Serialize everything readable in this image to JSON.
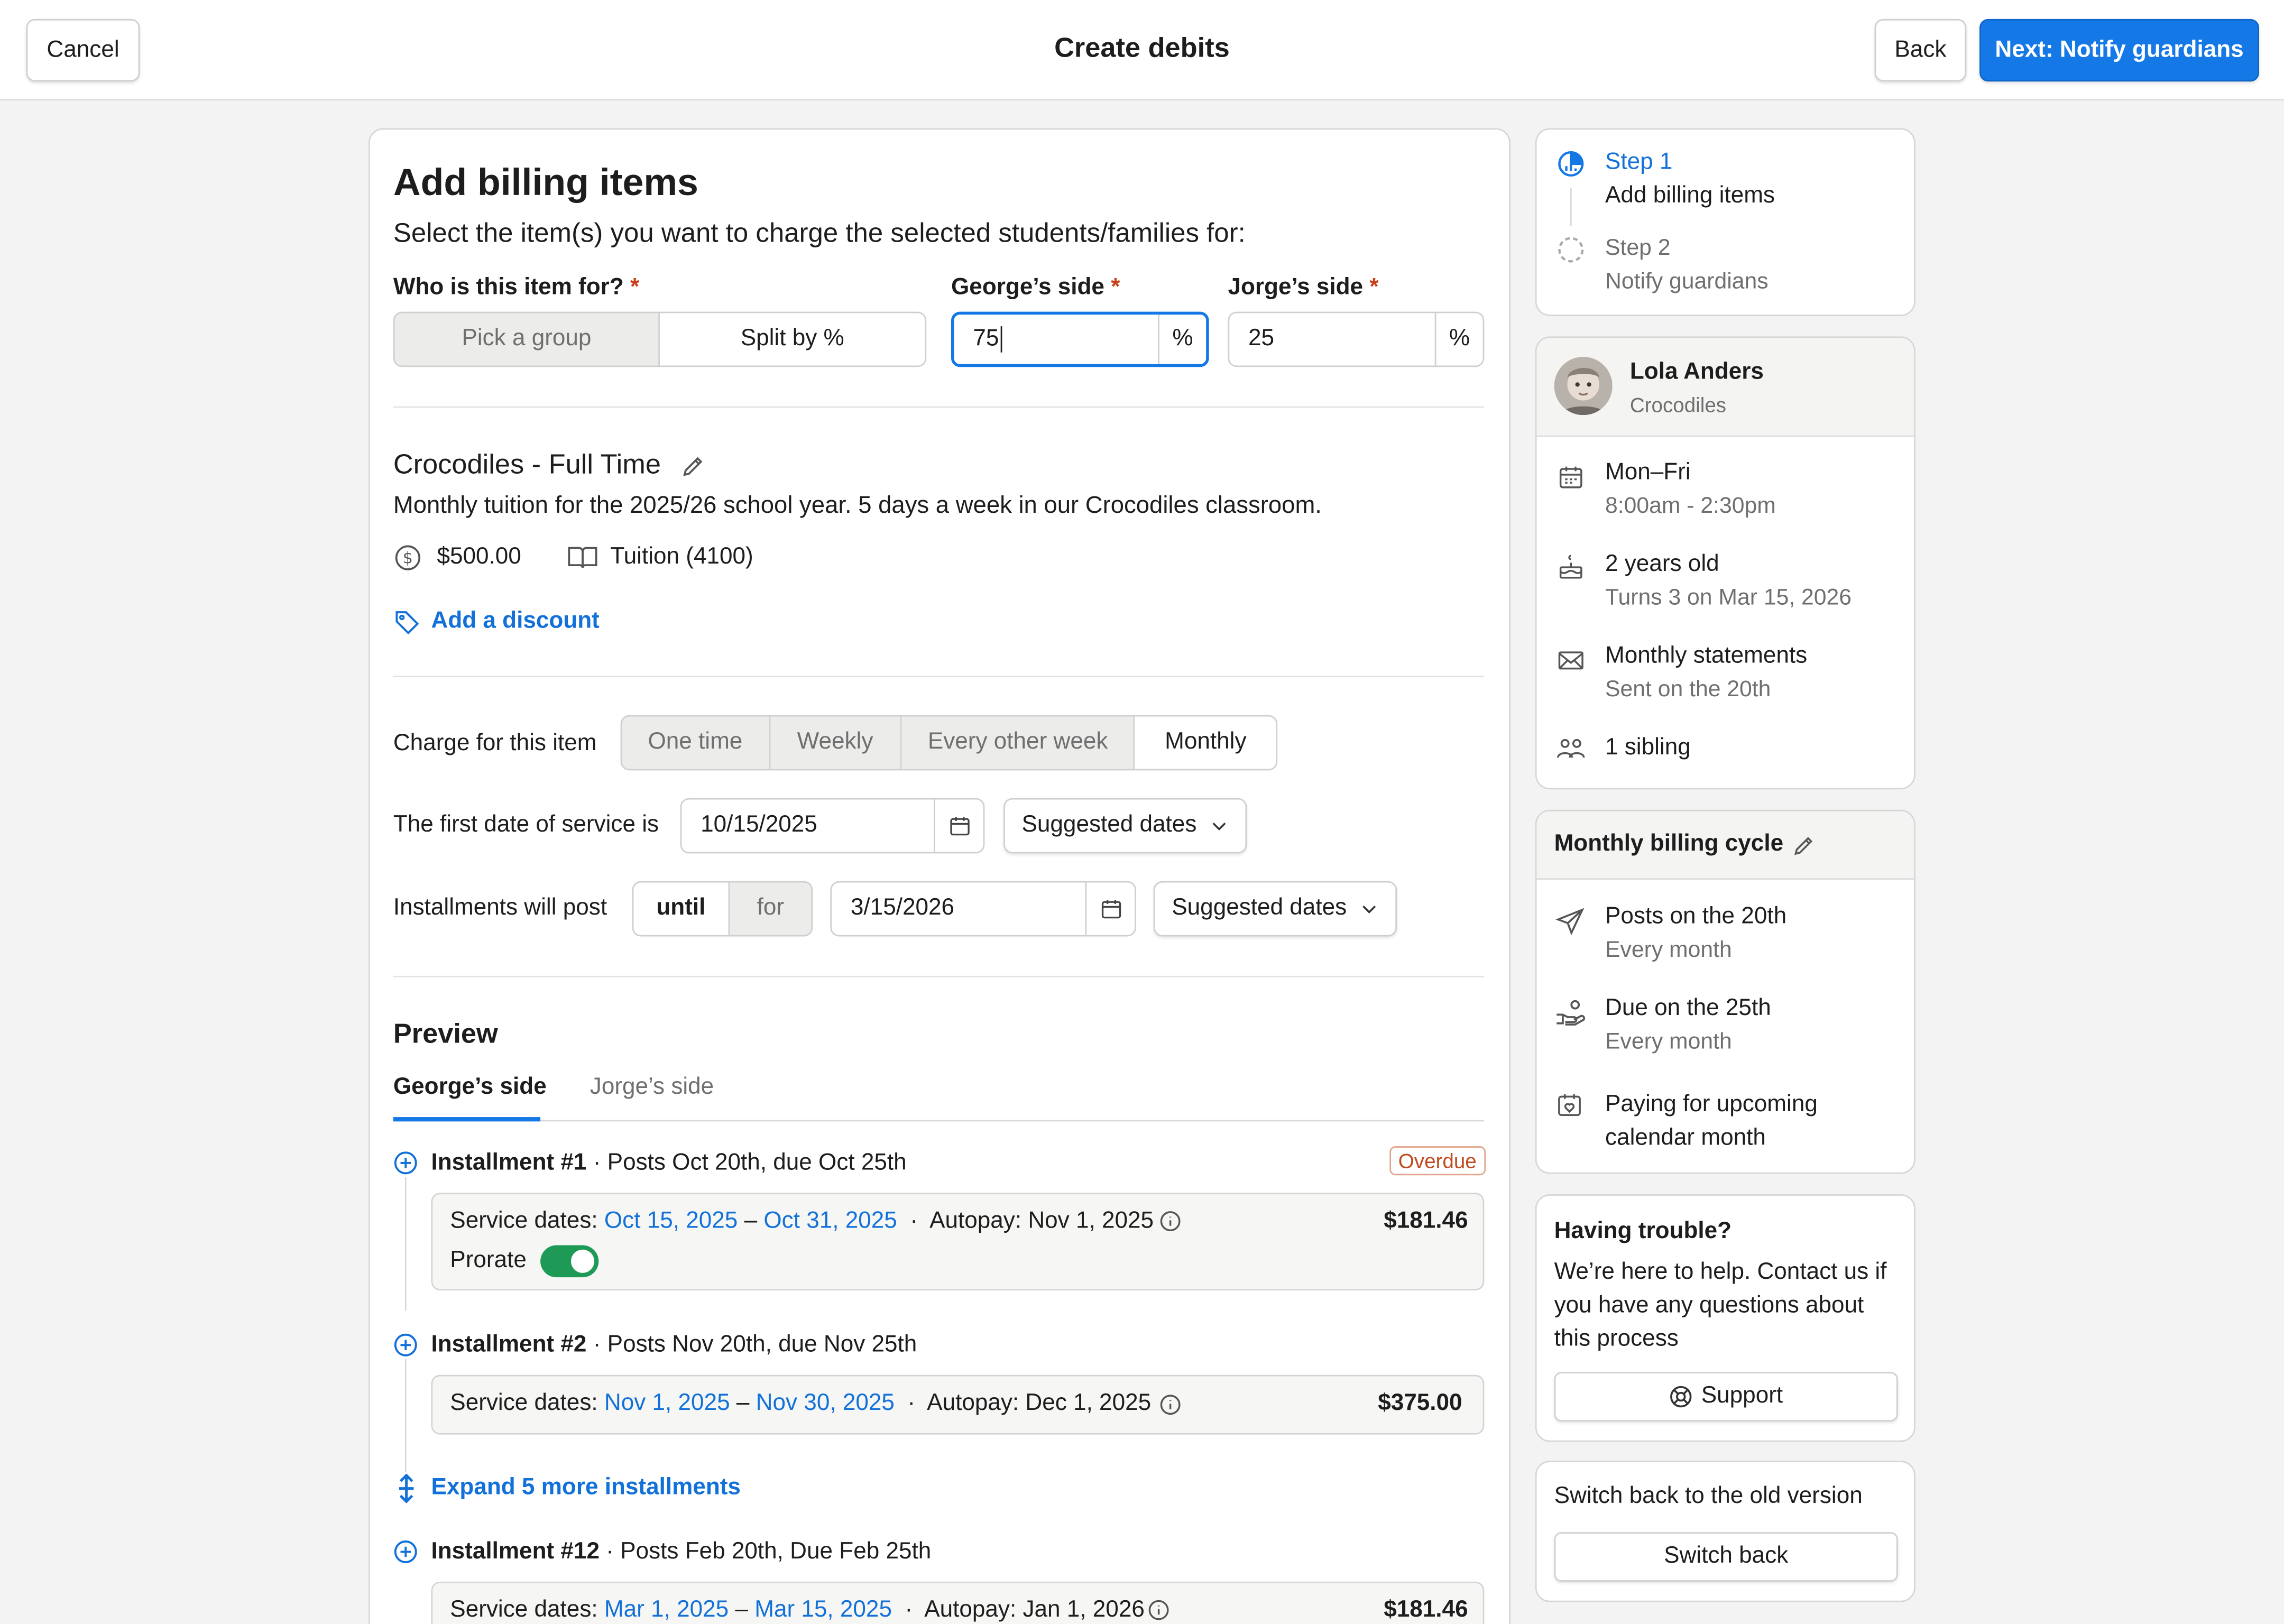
{
  "header": {
    "cancel_label": "Cancel",
    "title": "Create debits",
    "back_label": "Back",
    "next_label": "Next: Notify guardians"
  },
  "billing": {
    "title": "Add billing items",
    "subtitle": "Select the item(s) you want to charge the selected students/families for:",
    "who_label": "Who is this item for?",
    "who_options": [
      "Pick a group",
      "Split by %"
    ],
    "who_selected": "Split by %",
    "george_label": "George’s side",
    "george_value": "75",
    "jorge_label": "Jorge’s side",
    "jorge_value": "25",
    "percent": "%",
    "required_mark": "*"
  },
  "item": {
    "name": "Crocodiles - Full Time",
    "description": "Monthly tuition for the 2025/26 school year. 5 days a week in our Crocodiles classroom.",
    "price": "$500.00",
    "account": "Tuition (4100)",
    "discount_label": "Add a discount"
  },
  "charge": {
    "label": "Charge for this item",
    "options": [
      "One time",
      "Weekly",
      "Every other week",
      "Monthly"
    ],
    "selected": "Monthly",
    "first_date_label": "The first date of service is",
    "first_date": "10/15/2025",
    "suggested_label": "Suggested dates",
    "installments_label": "Installments will post",
    "until_label": "until",
    "for_label": "for",
    "end_date": "3/15/2026"
  },
  "preview": {
    "title": "Preview",
    "tabs": [
      "George’s side",
      "Jorge’s side"
    ],
    "active_tab": "George’s side",
    "installments": [
      {
        "title": "Installment #1",
        "schedule": "Posts Oct 20th, due Oct 25th",
        "badge": "Overdue",
        "service_label": "Service dates:",
        "start": "Oct 15, 2025",
        "end": "Oct 31, 2025",
        "autopay": "Autopay: Nov 1, 2025",
        "amount": "$181.46",
        "prorate_label": "Prorate"
      },
      {
        "title": "Installment #2",
        "schedule": "Posts Nov 20th, due Nov 25th",
        "service_label": "Service dates:",
        "start": "Nov 1, 2025",
        "end": "Nov 30, 2025",
        "autopay": "Autopay: Dec 1, 2025",
        "amount": "$375.00"
      },
      {
        "title": "Installment #12",
        "schedule": "Posts Feb 20th, Due Feb 25th",
        "service_label": "Service dates:",
        "start": "Mar 1, 2025",
        "end": "Mar 15, 2025",
        "autopay": "Autopay: Jan 1, 2026",
        "amount": "$181.46"
      }
    ],
    "expand_label": "Expand 5 more installments",
    "separator": "·",
    "dash": "–"
  },
  "steps": [
    {
      "step": "Step 1",
      "name": "Add billing items"
    },
    {
      "step": "Step 2",
      "name": "Notify guardians"
    }
  ],
  "student": {
    "name": "Lola Anders",
    "group": "Crocodiles",
    "details": [
      {
        "icon": "calendar-icon",
        "main": "Mon–Fri",
        "sub": "8:00am - 2:30pm"
      },
      {
        "icon": "cake-icon",
        "main": "2 years old",
        "sub": "Turns 3 on Mar 15, 2026"
      },
      {
        "icon": "envelope-icon",
        "main": "Monthly statements",
        "sub": "Sent on the 20th"
      },
      {
        "icon": "people-icon",
        "main": "1 sibling",
        "sub": ""
      }
    ]
  },
  "cycle": {
    "title": "Monthly billing cycle",
    "items": [
      {
        "main": "Posts on the 20th",
        "sub": "Every month"
      },
      {
        "main": "Due on the 25th",
        "sub": "Every month"
      },
      {
        "main": "Paying for upcoming calendar month",
        "sub": ""
      }
    ]
  },
  "help": {
    "title": "Having trouble?",
    "body": "We’re here to help. Contact us if you have any questions about this process",
    "support_label": "Support"
  },
  "old_version": {
    "title": "Switch back to the old version",
    "button_label": "Switch back"
  },
  "colors": {
    "primary": "#1478e6",
    "link": "#1271d9",
    "required": "#c9401b",
    "toggle_on": "#1f9a56",
    "overdue": "#c04a1e"
  }
}
